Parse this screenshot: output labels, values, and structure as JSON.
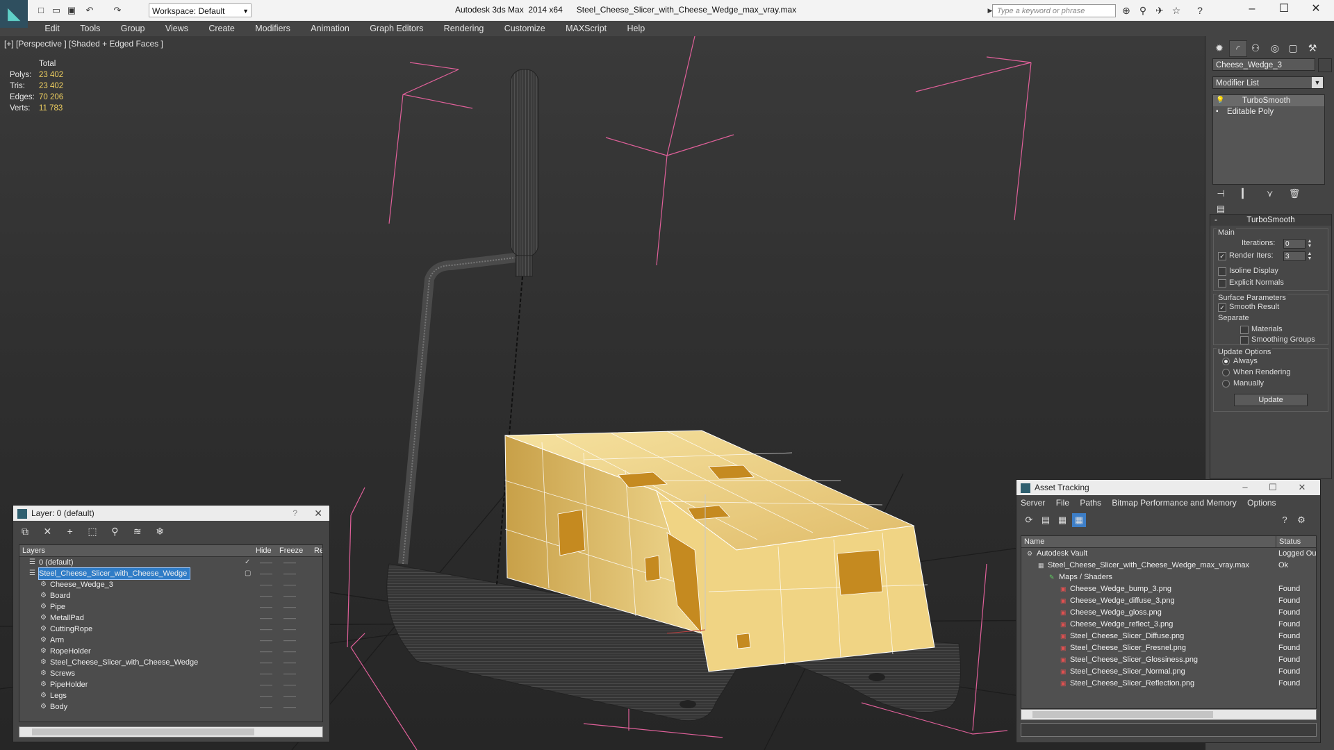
{
  "app": {
    "name": "Autodesk 3ds Max  2014 x64",
    "file": "Steel_Cheese_Slicer_with_Cheese_Wedge_max_vray.max",
    "workspace": "Workspace: Default",
    "search_placeholder": "Type a keyword or phrase"
  },
  "menu": [
    "Edit",
    "Tools",
    "Group",
    "Views",
    "Create",
    "Modifiers",
    "Animation",
    "Graph Editors",
    "Rendering",
    "Customize",
    "MAXScript",
    "Help"
  ],
  "viewport": {
    "label": "[+] [Perspective ] [Shaded + Edged Faces ]",
    "stats": {
      "header": "Total",
      "rows": [
        {
          "k": "Polys:",
          "v": "23 402"
        },
        {
          "k": "Tris:",
          "v": "23 402"
        },
        {
          "k": "Edges:",
          "v": "70 206"
        },
        {
          "k": "Verts:",
          "v": "11 783"
        }
      ]
    }
  },
  "command_panel": {
    "object_name": "Cheese_Wedge_3",
    "modifier_list": "Modifier List",
    "stack": [
      "TurboSmooth",
      "Editable Poly"
    ],
    "rollout": {
      "title": "TurboSmooth",
      "main_label": "Main",
      "iterations_label": "Iterations:",
      "iterations_value": "0",
      "render_iters_label": "Render Iters:",
      "render_iters_value": "3",
      "isoline": "Isoline Display",
      "explicit": "Explicit Normals",
      "surface_label": "Surface Parameters",
      "smooth_result": "Smooth Result",
      "separate": "Separate",
      "materials": "Materials",
      "smoothing_groups": "Smoothing Groups",
      "update_options": "Update Options",
      "always": "Always",
      "when_rendering": "When Rendering",
      "manually": "Manually",
      "update_button": "Update"
    }
  },
  "layer_window": {
    "title": "Layer: 0 (default)",
    "help": "?",
    "columns": {
      "layers": "Layers",
      "hide": "Hide",
      "freeze": "Freeze",
      "render": "Re"
    },
    "rows": [
      {
        "name": "0 (default)",
        "level": 0,
        "type": "layer",
        "checked": "✓"
      },
      {
        "name": "Steel_Cheese_Slicer_with_Cheese_Wedge",
        "level": 0,
        "type": "layer",
        "selected": true
      },
      {
        "name": "Cheese_Wedge_3",
        "level": 1,
        "type": "object"
      },
      {
        "name": "Board",
        "level": 1,
        "type": "object"
      },
      {
        "name": "Pipe",
        "level": 1,
        "type": "object"
      },
      {
        "name": "MetallPad",
        "level": 1,
        "type": "object"
      },
      {
        "name": "CuttingRope",
        "level": 1,
        "type": "object"
      },
      {
        "name": "Arm",
        "level": 1,
        "type": "object"
      },
      {
        "name": "RopeHolder",
        "level": 1,
        "type": "object"
      },
      {
        "name": "Steel_Cheese_Slicer_with_Cheese_Wedge",
        "level": 1,
        "type": "object"
      },
      {
        "name": "Screws",
        "level": 1,
        "type": "object"
      },
      {
        "name": "PipeHolder",
        "level": 1,
        "type": "object"
      },
      {
        "name": "Legs",
        "level": 1,
        "type": "object"
      },
      {
        "name": "Body",
        "level": 1,
        "type": "object"
      }
    ]
  },
  "asset_window": {
    "title": "Asset Tracking",
    "menu": [
      "Server",
      "File",
      "Paths",
      "Bitmap Performance and Memory",
      "Options"
    ],
    "columns": {
      "name": "Name",
      "status": "Status"
    },
    "rows": [
      {
        "name": "Autodesk Vault",
        "level": 0,
        "status": "Logged Ou"
      },
      {
        "name": "Steel_Cheese_Slicer_with_Cheese_Wedge_max_vray.max",
        "level": 1,
        "status": "Ok"
      },
      {
        "name": "Maps / Shaders",
        "level": 2,
        "status": ""
      },
      {
        "name": "Cheese_Wedge_bump_3.png",
        "level": 3,
        "status": "Found"
      },
      {
        "name": "Cheese_Wedge_diffuse_3.png",
        "level": 3,
        "status": "Found"
      },
      {
        "name": "Cheese_Wedge_gloss.png",
        "level": 3,
        "status": "Found"
      },
      {
        "name": "Cheese_Wedge_reflect_3.png",
        "level": 3,
        "status": "Found"
      },
      {
        "name": "Steel_Cheese_Slicer_Diffuse.png",
        "level": 3,
        "status": "Found"
      },
      {
        "name": "Steel_Cheese_Slicer_Fresnel.png",
        "level": 3,
        "status": "Found"
      },
      {
        "name": "Steel_Cheese_Slicer_Glossiness.png",
        "level": 3,
        "status": "Found"
      },
      {
        "name": "Steel_Cheese_Slicer_Normal.png",
        "level": 3,
        "status": "Found"
      },
      {
        "name": "Steel_Cheese_Slicer_Reflection.png",
        "level": 3,
        "status": "Found"
      }
    ]
  },
  "colors": {
    "cheese": "#e8c873",
    "selection_box": "#e0609a",
    "selected_layer": "#2f7cc7"
  }
}
